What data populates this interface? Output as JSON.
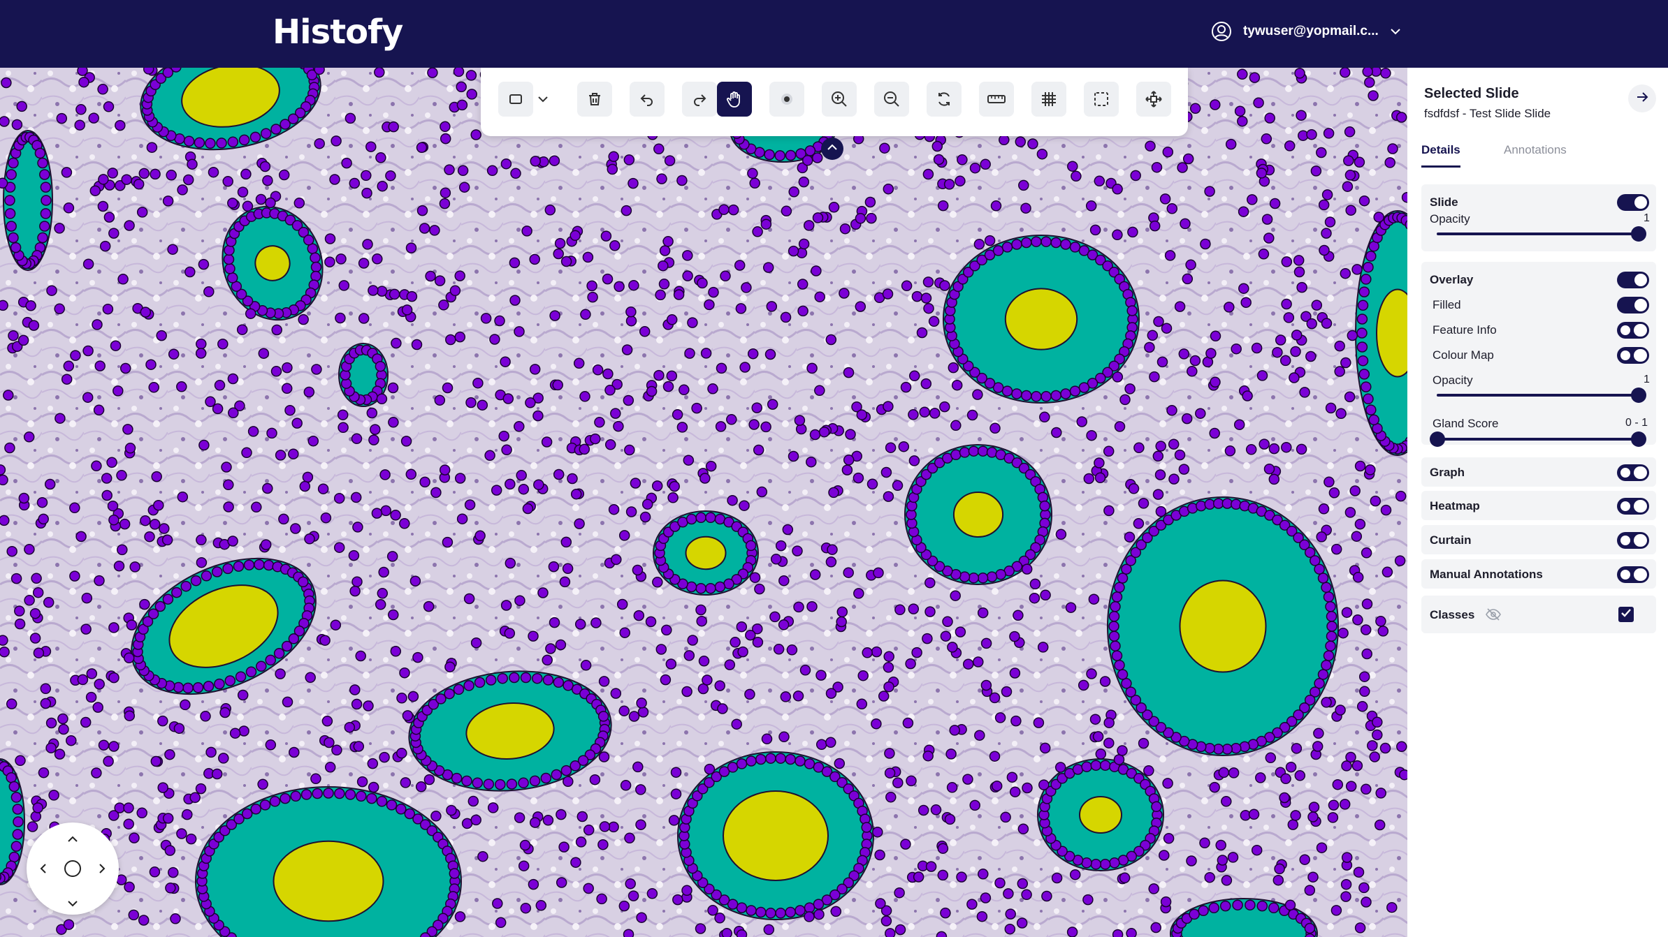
{
  "header": {
    "logo_text": "Histofy",
    "user_email": "tywuser@yopmail.c..."
  },
  "toolbar": {
    "tools": [
      {
        "name": "rectangle-tool",
        "icon": "square-icon"
      },
      {
        "name": "tool-dropdown",
        "icon": "chevron-down-icon"
      },
      {
        "name": "delete",
        "icon": "trash-icon"
      },
      {
        "name": "undo",
        "icon": "undo-icon"
      },
      {
        "name": "redo",
        "icon": "redo-icon"
      },
      {
        "name": "pan",
        "icon": "hand-icon",
        "active": true
      },
      {
        "name": "point",
        "icon": "dot-icon"
      },
      {
        "name": "zoom-in",
        "icon": "zoom-in-icon"
      },
      {
        "name": "zoom-out",
        "icon": "zoom-out-icon"
      },
      {
        "name": "reset-view",
        "icon": "refresh-icon"
      },
      {
        "name": "measure",
        "icon": "ruler-icon"
      },
      {
        "name": "grid",
        "icon": "grid-icon"
      },
      {
        "name": "region-select",
        "icon": "dashed-square-icon"
      },
      {
        "name": "fit",
        "icon": "move-icon"
      }
    ]
  },
  "panel": {
    "title": "Selected Slide",
    "subtitle": "fsdfdsf - Test Slide Slide",
    "tabs": [
      {
        "label": "Details",
        "active": true
      },
      {
        "label": "Annotations",
        "active": false
      }
    ],
    "slide": {
      "label": "Slide",
      "enabled": true,
      "opacity_label": "Opacity",
      "opacity_value": "1",
      "opacity_fraction": 1
    },
    "overlay": {
      "label": "Overlay",
      "enabled": true,
      "filled_label": "Filled",
      "filled": true,
      "feature_info_label": "Feature Info",
      "feature_info": false,
      "colour_map_label": "Colour Map",
      "colour_map": false,
      "opacity_label": "Opacity",
      "opacity_value": "1",
      "opacity_fraction": 1,
      "gland_score_label": "Gland Score",
      "gland_score_value": "0 - 1",
      "gland_score_range": [
        0,
        1
      ]
    },
    "graph": {
      "label": "Graph",
      "enabled": false
    },
    "heatmap": {
      "label": "Heatmap",
      "enabled": false
    },
    "curtain": {
      "label": "Curtain",
      "enabled": false
    },
    "manual_annotations": {
      "label": "Manual Annotations",
      "enabled": false
    },
    "classes": {
      "label": "Classes",
      "checked": true
    }
  },
  "colors": {
    "header_bg": "#161450",
    "gland_fill": "#00b2a0",
    "lumen_fill": "#d6d600",
    "nucleus_fill": "#7b00d6",
    "tissue_bg": "#d6cfe1"
  }
}
